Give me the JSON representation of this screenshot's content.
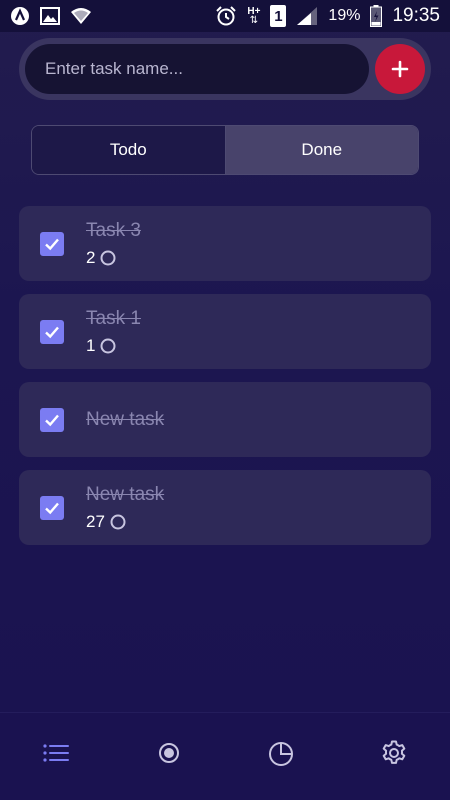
{
  "status_bar": {
    "left_icons": [
      "app-launcher-icon",
      "image-icon",
      "wifi-icon"
    ],
    "right_icons": [
      "alarm-icon",
      "hplus-signal-icon",
      "sim-1-icon",
      "cell-signal-icon",
      "battery-icon"
    ],
    "sim_label": "1",
    "network_label": "H+",
    "battery_percent": "19%",
    "time": "19:35"
  },
  "input": {
    "placeholder": "Enter task name...",
    "value": "",
    "add_button_icon": "plus-icon"
  },
  "tabs": [
    {
      "label": "Todo",
      "active": false
    },
    {
      "label": "Done",
      "active": true
    }
  ],
  "tasks": [
    {
      "title": "Task 3",
      "count": "2",
      "done": true,
      "has_meta": true
    },
    {
      "title": "Task 1",
      "count": "1",
      "done": true,
      "has_meta": true
    },
    {
      "title": "New task",
      "count": "",
      "done": true,
      "has_meta": false
    },
    {
      "title": "New task",
      "count": "27",
      "done": true,
      "has_meta": true
    }
  ],
  "bottom_nav": [
    {
      "icon": "list-icon",
      "active": true
    },
    {
      "icon": "half-moon-icon",
      "active": false
    },
    {
      "icon": "pie-chart-icon",
      "active": false
    },
    {
      "icon": "gear-icon",
      "active": false
    }
  ],
  "colors": {
    "background": "#1c1650",
    "card": "#2e2958",
    "accent": "#7b7cf2",
    "add_button": "#c8183a",
    "done_text": "#8a86b0"
  }
}
